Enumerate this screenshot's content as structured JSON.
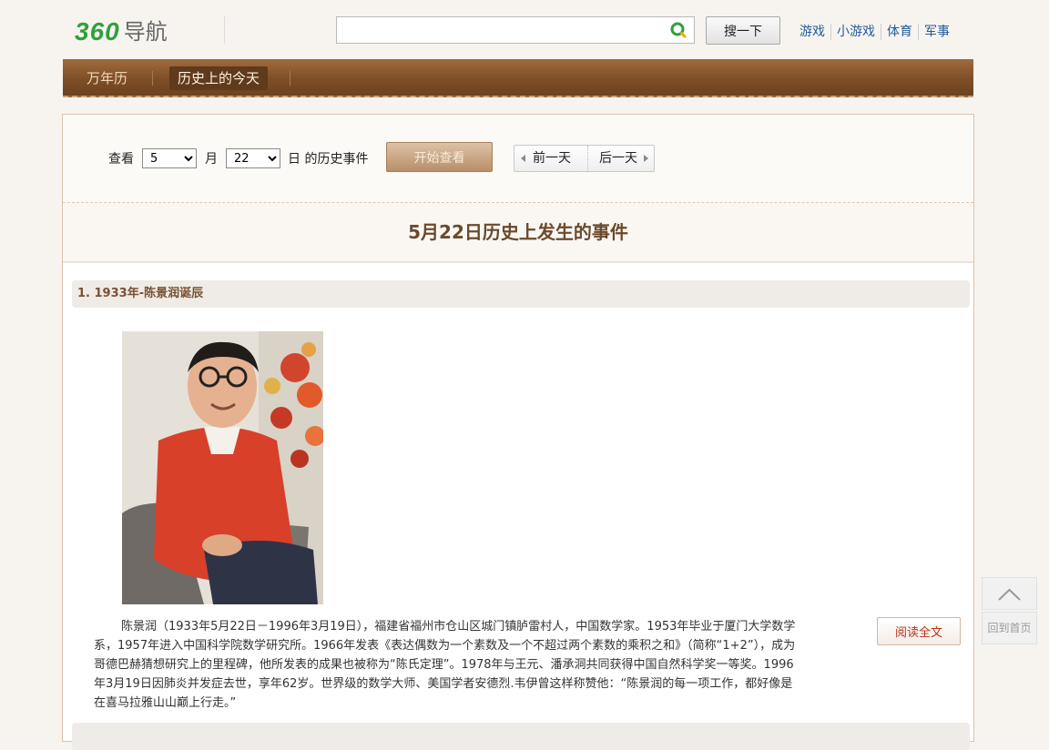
{
  "header": {
    "logo_number": "360",
    "logo_text": "导航",
    "search": {
      "value": "",
      "placeholder": ""
    },
    "search_button": "搜一下",
    "quick_links": [
      "游戏",
      "小游戏",
      "体育",
      "军事"
    ]
  },
  "nav": {
    "items": [
      {
        "label": "万年历",
        "active": false
      },
      {
        "label": "历史上的今天",
        "active": true
      }
    ]
  },
  "query": {
    "view_label": "查看",
    "month_value": "5",
    "month_unit": "月",
    "day_value": "22",
    "day_unit": "日 的历史事件",
    "start_button": "开始查看",
    "prev_day": "前一天",
    "next_day": "后一天"
  },
  "page_title": "5月22日历史上发生的事件",
  "events": [
    {
      "heading": "1. 1933年-陈景润诞辰",
      "text": "陈景润（1933年5月22日－1996年3月19日），福建省福州市仓山区城门镇胪雷村人，中国数学家。1953年毕业于厦门大学数学系，1957年进入中国科学院数学研究所。1966年发表《表达偶数为一个素数及一个不超过两个素数的乘积之和》（简称“1+2”），成为哥德巴赫猜想研究上的里程碑，他所发表的成果也被称为“陈氏定理”。1978年与王元、潘承洞共同获得中国自然科学奖一等奖。1996年3月19日因肺炎并发症去世，享年62岁。世界级的数学大师、美国学者安德烈.韦伊曾这样称赞他：“陈景润的每一项工作，都好像是在喜马拉雅山山巅上行走。”",
      "read_more": "阅读全文"
    }
  ],
  "floating": {
    "back_home": "回到首页"
  },
  "colors": {
    "nav_brown": "#7e4f27",
    "logo_green": "#2fa13a",
    "title_brown": "#6b4a2c",
    "link_blue": "#1f5d99",
    "read_red": "#b6321a"
  }
}
